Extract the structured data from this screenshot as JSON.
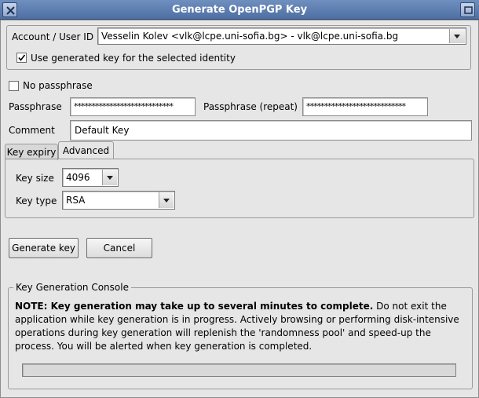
{
  "window": {
    "title": "Generate OpenPGP Key",
    "buttons": [
      "close-icon",
      "maximize-icon"
    ]
  },
  "identity": {
    "account_label": "Account / User ID",
    "account_value": "Vesselin Kolev <vlk@lcpe.uni-sofia.bg> - vlk@lcpe.uni-sofia.bg",
    "use_generated_label": "Use generated key for the selected identity",
    "use_generated_checked": true
  },
  "passphrase": {
    "no_passphrase_label": "No passphrase",
    "no_passphrase_checked": false,
    "passphrase_label": "Passphrase",
    "passphrase_value": "****************************",
    "repeat_label": "Passphrase (repeat)",
    "repeat_value": "****************************"
  },
  "comment": {
    "label": "Comment",
    "value": "Default Key"
  },
  "tabs": [
    {
      "label": "Key expiry",
      "active": false
    },
    {
      "label": "Advanced",
      "active": true
    }
  ],
  "advanced": {
    "key_size_label": "Key size",
    "key_size_value": "4096",
    "key_type_label": "Key type",
    "key_type_value": "RSA"
  },
  "actions": {
    "generate_label": "Generate key",
    "cancel_label": "Cancel"
  },
  "console": {
    "title": "Key Generation Console",
    "note_bold": "NOTE: Key generation may take up to several minutes to complete.",
    "note_rest": " Do not exit the application while key generation is in progress. Actively browsing or performing disk-intensive operations during key generation will replenish the 'randomness pool' and speed-up the process. You will be alerted when key generation is completed.",
    "progress": 0
  }
}
